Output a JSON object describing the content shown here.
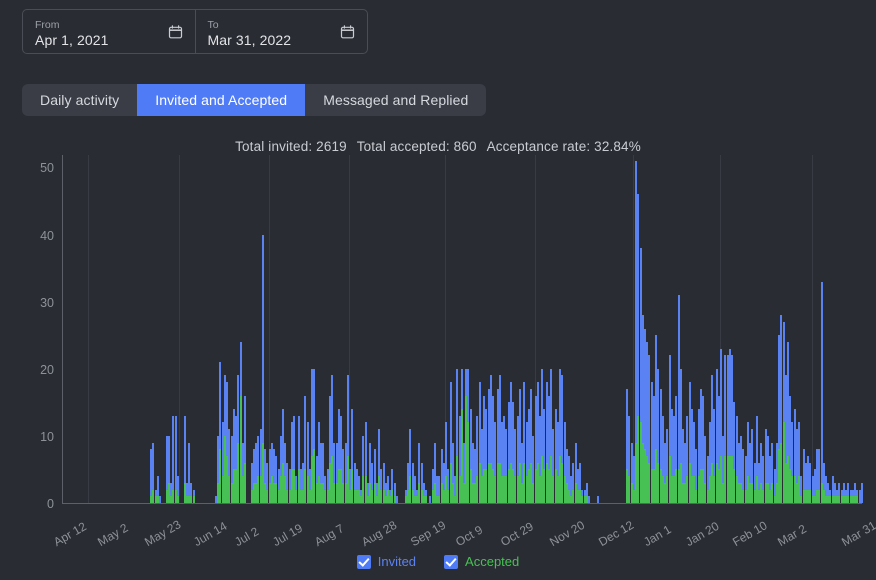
{
  "top_stub": {
    "text": ""
  },
  "date_range": {
    "from": {
      "label": "From",
      "value": "Apr 1, 2021",
      "icon": "calendar-icon"
    },
    "to": {
      "label": "To",
      "value": "Mar 31, 2022",
      "icon": "calendar-icon"
    }
  },
  "tabs": [
    {
      "label": "Daily activity",
      "active": false
    },
    {
      "label": "Invited and Accepted",
      "active": true
    },
    {
      "label": "Messaged and Replied",
      "active": false
    }
  ],
  "stats": {
    "total_invited": "Total invited: 2619",
    "total_accepted": "Total accepted: 860",
    "acceptance_rate": "Acceptance rate: 32.84%"
  },
  "legend": [
    {
      "label": "Invited",
      "checked": true,
      "color": "#5b82f3"
    },
    {
      "label": "Accepted",
      "checked": true,
      "color": "#48c154"
    }
  ],
  "colors": {
    "background": "#2a2c33",
    "invited": "#5b82f3",
    "accepted": "#48c154",
    "accent": "#4f7bf7",
    "axis": "#5d6068",
    "grid": "#383b43",
    "text": "#c9ccd2",
    "muted": "#8d9198"
  },
  "chart_data": {
    "type": "bar",
    "title": "Invited and Accepted",
    "xlabel": "",
    "ylabel": "",
    "ylim": [
      0,
      52
    ],
    "yticks": [
      0,
      10,
      20,
      30,
      40,
      50
    ],
    "grid": "vertical-only",
    "legend_position": "bottom-center",
    "stacking": "overlay",
    "x_tick_labels": [
      "Apr 12",
      "May 2",
      "May 23",
      "Jun 14",
      "Jul 2",
      "Jul 19",
      "Aug 7",
      "Aug 28",
      "Sep 19",
      "Oct 9",
      "Oct 29",
      "Nov 20",
      "Dec 12",
      "Jan 1",
      "Jan 20",
      "Feb 10",
      "Mar 2",
      "Mar 31"
    ],
    "x_tick_indices": [
      11,
      31,
      52,
      74,
      92,
      109,
      128,
      149,
      171,
      191,
      211,
      233,
      255,
      275,
      294,
      315,
      335,
      364
    ],
    "x_start": "Apr 1, 2021",
    "x_end": "Mar 31, 2022",
    "series": [
      {
        "name": "Invited",
        "color": "#5b82f3",
        "values": [
          0,
          0,
          0,
          0,
          0,
          0,
          0,
          0,
          0,
          0,
          0,
          0,
          0,
          0,
          0,
          0,
          0,
          0,
          0,
          0,
          0,
          0,
          0,
          0,
          0,
          0,
          0,
          0,
          0,
          0,
          0,
          0,
          0,
          0,
          0,
          0,
          0,
          0,
          0,
          8,
          9,
          2,
          4,
          1,
          0,
          0,
          10,
          10,
          3,
          13,
          13,
          4,
          0,
          0,
          13,
          3,
          9,
          3,
          2,
          0,
          0,
          0,
          0,
          0,
          0,
          0,
          0,
          0,
          1,
          10,
          21,
          12,
          19,
          18,
          11,
          10,
          14,
          13,
          19,
          24,
          9,
          16,
          0,
          0,
          6,
          8,
          9,
          10,
          11,
          40,
          8,
          6,
          8,
          9,
          8,
          7,
          5,
          10,
          14,
          9,
          6,
          5,
          12,
          13,
          4,
          13,
          5,
          6,
          16,
          12,
          5,
          20,
          20,
          7,
          12,
          9,
          9,
          4,
          5,
          16,
          19,
          9,
          9,
          14,
          13,
          8,
          9,
          19,
          5,
          14,
          6,
          5,
          4,
          2,
          10,
          12,
          3,
          9,
          6,
          8,
          3,
          11,
          5,
          6,
          3,
          4,
          2,
          5,
          3,
          1,
          0,
          0,
          0,
          2,
          6,
          11,
          6,
          4,
          2,
          9,
          6,
          3,
          2,
          0,
          1,
          5,
          9,
          4,
          4,
          8,
          6,
          12,
          5,
          18,
          9,
          4,
          20,
          13,
          20,
          9,
          20,
          20,
          14,
          9,
          8,
          13,
          18,
          11,
          16,
          14,
          17,
          19,
          16,
          12,
          17,
          19,
          12,
          13,
          11,
          15,
          18,
          15,
          11,
          13,
          17,
          9,
          18,
          12,
          14,
          17,
          10,
          16,
          18,
          13,
          20,
          14,
          18,
          16,
          20,
          11,
          14,
          12,
          20,
          19,
          12,
          8,
          7,
          4,
          6,
          9,
          5,
          6,
          2,
          2,
          3,
          1,
          0,
          0,
          0,
          1,
          0,
          0,
          0,
          0,
          0,
          0,
          0,
          0,
          0,
          0,
          0,
          0,
          17,
          13,
          9,
          7,
          51,
          46,
          38,
          28,
          26,
          24,
          22,
          18,
          16,
          25,
          20,
          17,
          13,
          9,
          11,
          22,
          14,
          13,
          16,
          31,
          20,
          11,
          9,
          13,
          18,
          14,
          12,
          8,
          14,
          17,
          16,
          10,
          7,
          12,
          19,
          14,
          20,
          16,
          23,
          10,
          22,
          22,
          23,
          22,
          15,
          13,
          9,
          10,
          8,
          7,
          12,
          9,
          11,
          6,
          13,
          6,
          9,
          7,
          11,
          10,
          7,
          9,
          5,
          9,
          25,
          28,
          27,
          19,
          24,
          16,
          12,
          14,
          11,
          12,
          4,
          8,
          6,
          7,
          6,
          4,
          5,
          8,
          8,
          33,
          6,
          4,
          3,
          2,
          4,
          3,
          2,
          3,
          2,
          3,
          2,
          3,
          2,
          2,
          3,
          2,
          2,
          3
        ]
      },
      {
        "name": "Accepted",
        "color": "#48c154",
        "values": [
          0,
          0,
          0,
          0,
          0,
          0,
          0,
          0,
          0,
          0,
          0,
          0,
          0,
          0,
          0,
          0,
          0,
          0,
          0,
          0,
          0,
          0,
          0,
          0,
          0,
          0,
          0,
          0,
          0,
          0,
          0,
          0,
          0,
          0,
          0,
          0,
          0,
          0,
          0,
          1,
          2,
          1,
          1,
          0,
          0,
          0,
          2,
          3,
          1,
          2,
          2,
          1,
          0,
          0,
          3,
          1,
          1,
          1,
          1,
          0,
          0,
          0,
          0,
          0,
          0,
          0,
          0,
          0,
          0,
          3,
          8,
          4,
          10,
          7,
          4,
          3,
          5,
          5,
          9,
          16,
          4,
          6,
          0,
          0,
          2,
          3,
          3,
          4,
          4,
          9,
          3,
          2,
          3,
          4,
          3,
          3,
          2,
          4,
          6,
          4,
          2,
          2,
          5,
          5,
          2,
          5,
          2,
          2,
          5,
          4,
          2,
          7,
          8,
          3,
          4,
          3,
          3,
          2,
          2,
          6,
          7,
          3,
          3,
          5,
          5,
          3,
          3,
          7,
          2,
          5,
          2,
          2,
          2,
          1,
          4,
          4,
          1,
          3,
          2,
          3,
          1,
          4,
          2,
          2,
          1,
          2,
          1,
          2,
          1,
          0,
          0,
          0,
          0,
          1,
          2,
          4,
          2,
          1,
          1,
          3,
          2,
          1,
          1,
          0,
          0,
          2,
          3,
          1,
          1,
          3,
          2,
          4,
          2,
          6,
          3,
          1,
          7,
          4,
          14,
          3,
          16,
          12,
          5,
          3,
          3,
          4,
          6,
          4,
          5,
          5,
          6,
          6,
          5,
          4,
          6,
          6,
          4,
          4,
          4,
          5,
          6,
          5,
          4,
          4,
          6,
          3,
          6,
          4,
          5,
          6,
          3,
          5,
          6,
          4,
          7,
          5,
          6,
          5,
          7,
          4,
          5,
          4,
          7,
          6,
          4,
          3,
          2,
          1,
          2,
          3,
          2,
          2,
          1,
          1,
          1,
          0,
          0,
          0,
          0,
          0,
          0,
          0,
          0,
          0,
          0,
          0,
          0,
          0,
          0,
          0,
          0,
          0,
          5,
          4,
          3,
          2,
          9,
          13,
          12,
          9,
          8,
          7,
          6,
          5,
          5,
          8,
          6,
          5,
          4,
          3,
          4,
          7,
          4,
          4,
          5,
          5,
          6,
          3,
          3,
          4,
          6,
          4,
          4,
          2,
          4,
          5,
          5,
          3,
          2,
          4,
          6,
          4,
          6,
          5,
          7,
          3,
          7,
          7,
          7,
          7,
          5,
          4,
          3,
          3,
          2,
          2,
          4,
          3,
          3,
          2,
          4,
          2,
          3,
          2,
          3,
          3,
          2,
          3,
          1,
          3,
          8,
          9,
          12,
          6,
          7,
          5,
          4,
          4,
          3,
          4,
          1,
          2,
          2,
          2,
          2,
          1,
          1,
          2,
          2,
          3,
          2,
          1,
          1,
          1,
          1,
          1,
          1,
          1,
          1,
          1,
          1,
          1,
          1,
          1,
          1,
          1
        ]
      }
    ]
  }
}
